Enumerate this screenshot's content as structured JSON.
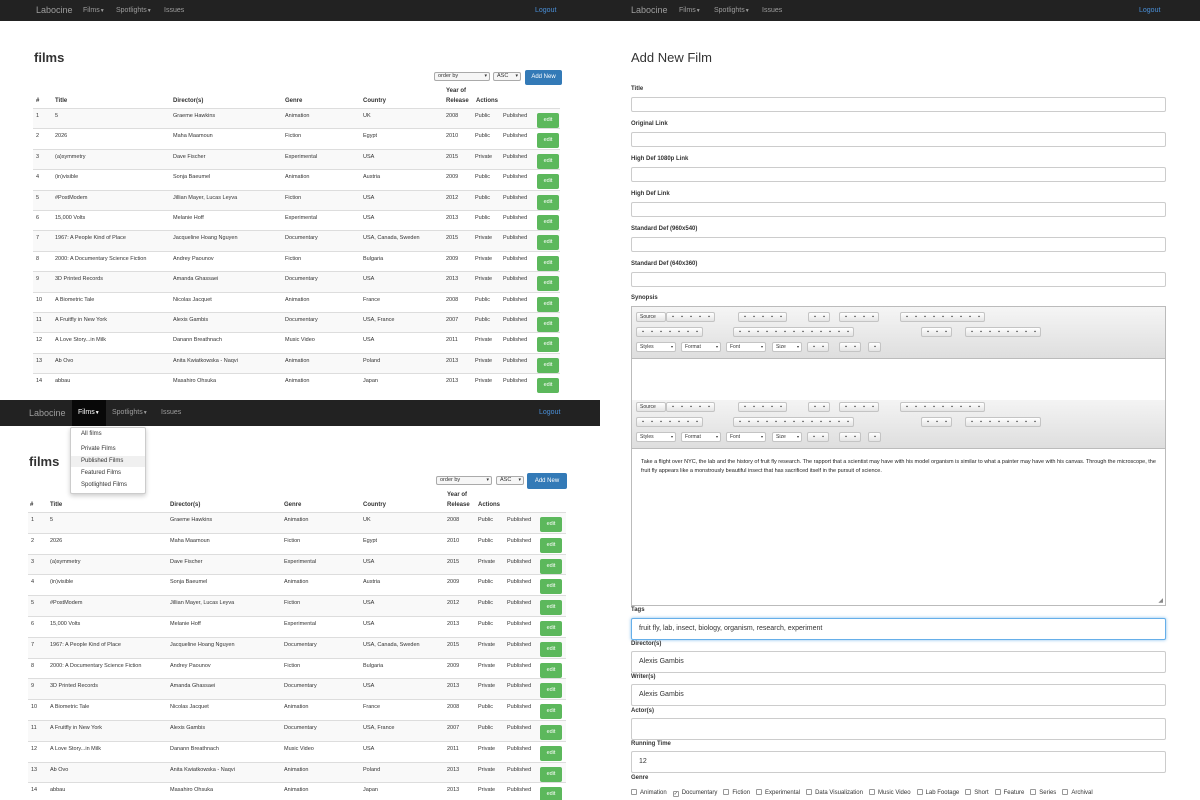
{
  "nav": {
    "brand": "Labocine",
    "films": "Films",
    "spotlights": "Spotlights",
    "issues": "Issues",
    "logout": "Logout"
  },
  "list": {
    "title": "films",
    "order_by": "order by",
    "sort_dir": "ASC",
    "add_new": "Add New",
    "headers": {
      "num": "#",
      "title": "Title",
      "director": "Director(s)",
      "genre": "Genre",
      "country": "Country",
      "year1": "Year of",
      "year2": "Release",
      "actions": "Actions"
    },
    "edit_label": "edit",
    "rows": [
      {
        "n": "1",
        "title": "5",
        "director": "Graeme Hawkins",
        "genre": "Animation",
        "country": "UK",
        "year": "2008",
        "vis": "Public",
        "status": "Published"
      },
      {
        "n": "2",
        "title": "2026",
        "director": "Maha Maamoun",
        "genre": "Fiction",
        "country": "Egypt",
        "year": "2010",
        "vis": "Public",
        "status": "Published"
      },
      {
        "n": "3",
        "title": "(a)symmetry",
        "director": "Dave Fischer",
        "genre": "Experimental",
        "country": "USA",
        "year": "2015",
        "vis": "Private",
        "status": "Published"
      },
      {
        "n": "4",
        "title": "(in)visible",
        "director": "Sonja Baeumel",
        "genre": "Animation",
        "country": "Austria",
        "year": "2009",
        "vis": "Public",
        "status": "Published"
      },
      {
        "n": "5",
        "title": "#PostModem",
        "director": "Jillian Mayer, Lucas Leyva",
        "genre": "Fiction",
        "country": "USA",
        "year": "2012",
        "vis": "Public",
        "status": "Published"
      },
      {
        "n": "6",
        "title": "15,000 Volts",
        "director": "Melanie Hoff",
        "genre": "Experimental",
        "country": "USA",
        "year": "2013",
        "vis": "Public",
        "status": "Published"
      },
      {
        "n": "7",
        "title": "1967: A People Kind of Place",
        "director": "Jacqueline Hoang Nguyen",
        "genre": "Documentary",
        "country": "USA, Canada, Sweden",
        "year": "2015",
        "vis": "Private",
        "status": "Published"
      },
      {
        "n": "8",
        "title": "2000: A Documentary Science Fiction",
        "director": "Andrey Paounov",
        "genre": "Fiction",
        "country": "Bulgaria",
        "year": "2009",
        "vis": "Private",
        "status": "Published"
      },
      {
        "n": "9",
        "title": "3D Printed Records",
        "director": "Amanda Ghassaei",
        "genre": "Documentary",
        "country": "USA",
        "year": "2013",
        "vis": "Private",
        "status": "Published"
      },
      {
        "n": "10",
        "title": "A Biometric Tale",
        "director": "Nicolas Jacquet",
        "genre": "Animation",
        "country": "France",
        "year": "2008",
        "vis": "Public",
        "status": "Published"
      },
      {
        "n": "11",
        "title": "A Fruitfly in New York",
        "director": "Alexis Gambis",
        "genre": "Documentary",
        "country": "USA, France",
        "year": "2007",
        "vis": "Public",
        "status": "Published"
      },
      {
        "n": "12",
        "title": "A Love Story...in Milk",
        "director": "Danann Breathnach",
        "genre": "Music Video",
        "country": "USA",
        "year": "2011",
        "vis": "Private",
        "status": "Published"
      },
      {
        "n": "13",
        "title": "Ab Ovo",
        "director": "Anita Kwiatkowska - Naqvi",
        "genre": "Animation",
        "country": "Poland",
        "year": "2013",
        "vis": "Private",
        "status": "Published"
      },
      {
        "n": "14",
        "title": "abbau",
        "director": "Masahiro Ohsuka",
        "genre": "Animation",
        "country": "Japan",
        "year": "2013",
        "vis": "Private",
        "status": "Published"
      }
    ]
  },
  "films_menu": [
    "All films",
    "Private Films",
    "Published Films",
    "Featured Films",
    "Spotlighted Films"
  ],
  "form": {
    "title": "Add New Film",
    "labels": {
      "title": "Title",
      "original_link": "Original Link",
      "hd1080": "High Def 1080p Link",
      "hd": "High Def Link",
      "sd960": "Standard Def (960x540)",
      "sd640": "Standard Def (640x360)",
      "synopsis": "Synopsis",
      "tags": "Tags",
      "directors": "Director(s)",
      "writers": "Writer(s)",
      "actors": "Actor(s)",
      "running_time": "Running Time",
      "genre": "Genre"
    },
    "values": {
      "tags": "fruit fly, lab, insect, biology, organism, research, experiment",
      "directors": "Alexis Gambis",
      "writers": "Alexis Gambis",
      "actors": "",
      "running_time": "12"
    },
    "synopsis_text": "Take a flight over NYC, the lab and the history of fruit fly research. The rapport that a scientist may have with his model organism is similar to what a painter may have with his canvas. Through the microscope, the fruit fly appears like a monstrously beautiful insect that has sacrificed itself in the pursuit of science.",
    "toolbar": {
      "source": "Source",
      "styles": "Styles",
      "format": "Format",
      "font": "Font",
      "size": "Size"
    },
    "genres": [
      {
        "label": "Animation",
        "checked": false
      },
      {
        "label": "Documentary",
        "checked": true
      },
      {
        "label": "Fiction",
        "checked": false
      },
      {
        "label": "Experimental",
        "checked": false
      },
      {
        "label": "Data Visualization",
        "checked": false
      },
      {
        "label": "Music Video",
        "checked": false
      },
      {
        "label": "Lab Footage",
        "checked": false
      },
      {
        "label": "Short",
        "checked": false
      },
      {
        "label": "Feature",
        "checked": false
      },
      {
        "label": "Series",
        "checked": false
      },
      {
        "label": "Archival",
        "checked": false
      }
    ]
  }
}
